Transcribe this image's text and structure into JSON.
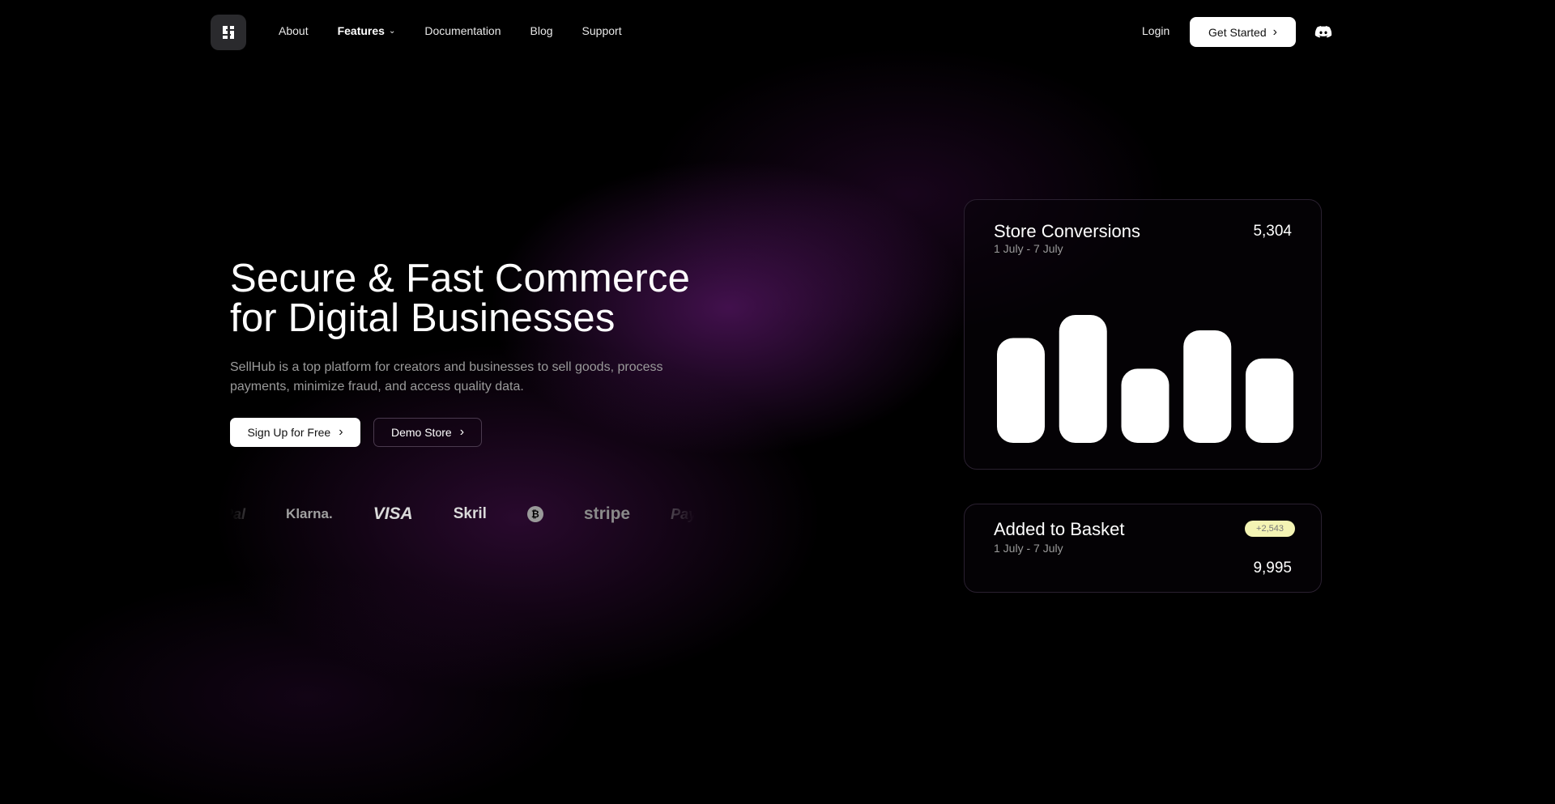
{
  "nav": {
    "links": [
      {
        "label": "About"
      },
      {
        "label": "Features",
        "has_dropdown": true
      },
      {
        "label": "Documentation"
      },
      {
        "label": "Blog"
      },
      {
        "label": "Support"
      }
    ],
    "login": "Login",
    "get_started": "Get Started",
    "icons": {
      "logo": "sellhub-logo-icon",
      "discord": "discord-icon",
      "chevron": "chevron-down-icon",
      "arrow": "chevron-right-icon"
    }
  },
  "hero": {
    "headline_line1": "Secure & Fast Commerce",
    "headline_line2": "for Digital Businesses",
    "subtext": "SellHub is a top platform for creators and businesses to sell goods, process payments, minimize fraud, and access quality data.",
    "primary_button": "Sign Up for Free",
    "secondary_button": "Demo Store"
  },
  "payment_logos": [
    "PayPal",
    "Klarna.",
    "VISA",
    "Skril",
    "bitcoin",
    "stripe",
    "PayPal"
  ],
  "cards": {
    "conversions": {
      "title": "Store Conversions",
      "date_range": "1 July - 7 July",
      "value": "5,304"
    },
    "basket": {
      "title": "Added to Basket",
      "date_range": "1 July - 7 July",
      "value": "9,995",
      "badge": "+2,543"
    }
  },
  "chart_data": {
    "type": "bar",
    "title": "Store Conversions",
    "values": [
      0.82,
      1.0,
      0.58,
      0.88,
      0.66
    ],
    "bar_color": "#ffffff"
  },
  "colors": {
    "background": "#000000",
    "glow": "#7a1e8c",
    "badge_bg": "#f4f4b4"
  }
}
